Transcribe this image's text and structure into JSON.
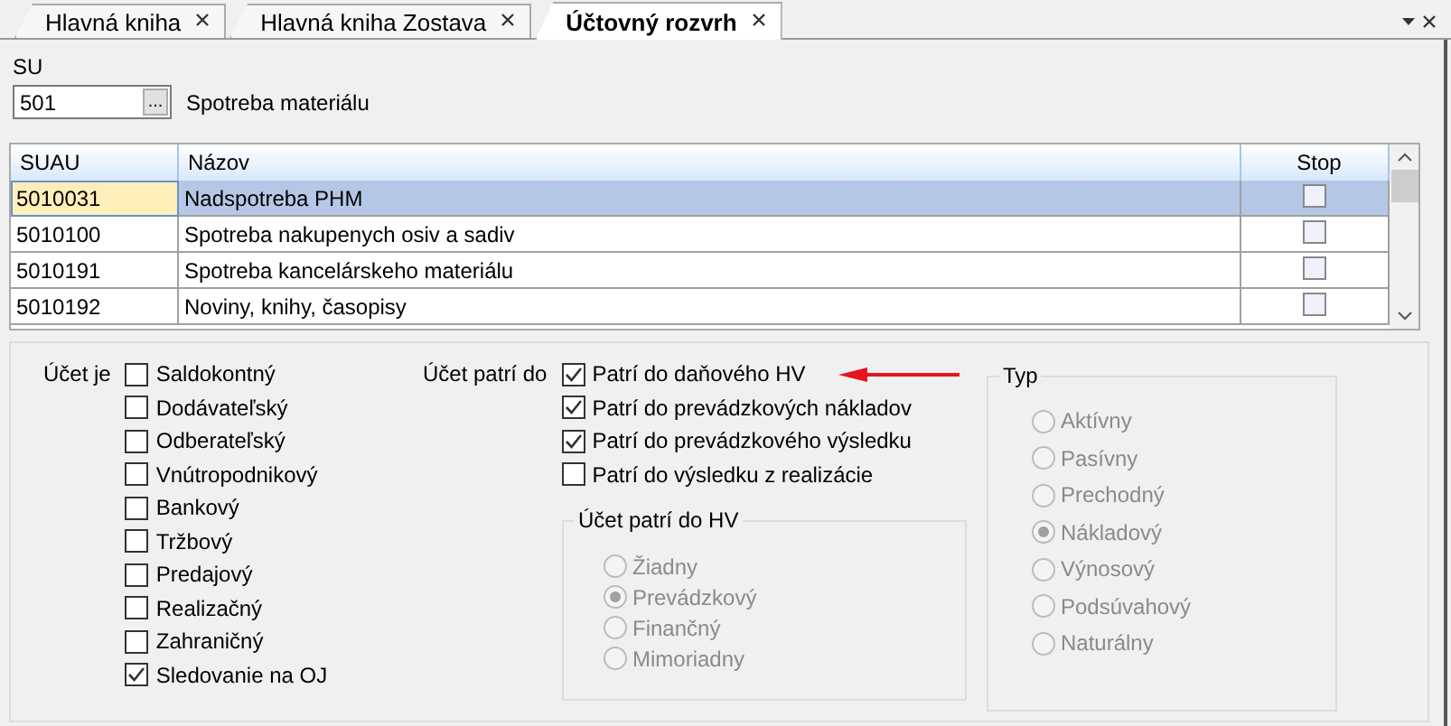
{
  "tabs": [
    {
      "label": "Hlavná kniha",
      "selected": false
    },
    {
      "label": "Hlavná kniha Zostava",
      "selected": false
    },
    {
      "label": "Účtovný rozvrh",
      "selected": true
    }
  ],
  "su": {
    "label": "SU",
    "value": "501",
    "button": "...",
    "description": "Spotreba materiálu"
  },
  "table": {
    "columns": [
      "SUAU",
      "Názov",
      "Stop"
    ],
    "rows": [
      {
        "suau": "5010031",
        "nazov": "Nadspotreba PHM",
        "stop": false,
        "selected": true
      },
      {
        "suau": "5010100",
        "nazov": "Spotreba nakupenych osiv a sadiv",
        "stop": false,
        "selected": false
      },
      {
        "suau": "5010191",
        "nazov": "Spotreba kancelárskeho materiálu",
        "stop": false,
        "selected": false
      },
      {
        "suau": "5010192",
        "nazov": "Noviny, knihy, časopisy",
        "stop": false,
        "selected": false
      }
    ]
  },
  "account_is": {
    "label": "Účet je",
    "items": [
      {
        "label": "Saldokontný",
        "checked": false
      },
      {
        "label": "Dodávateľský",
        "checked": false
      },
      {
        "label": "Odberateľský",
        "checked": false
      },
      {
        "label": "Vnútropodnikový",
        "checked": false
      },
      {
        "label": "Bankový",
        "checked": false
      },
      {
        "label": "Tržbový",
        "checked": false
      },
      {
        "label": "Predajový",
        "checked": false
      },
      {
        "label": "Realizačný",
        "checked": false
      },
      {
        "label": "Zahraničný",
        "checked": false
      },
      {
        "label": "Sledovanie na OJ",
        "checked": true
      }
    ]
  },
  "belongs_to": {
    "label": "Účet patrí do",
    "items": [
      {
        "label": "Patrí do daňového HV",
        "checked": true,
        "annotated": true
      },
      {
        "label": "Patrí do prevádzkových nákladov",
        "checked": true,
        "annotated": false
      },
      {
        "label": "Patrí do prevádzkového výsledku",
        "checked": true,
        "annotated": false
      },
      {
        "label": "Patrí do výsledku z realizácie",
        "checked": false,
        "annotated": false
      }
    ]
  },
  "hv_group": {
    "title": "Účet patrí do HV",
    "disabled": true,
    "options": [
      {
        "label": "Žiadny",
        "selected": false
      },
      {
        "label": "Prevádzkový",
        "selected": true
      },
      {
        "label": "Finančný",
        "selected": false
      },
      {
        "label": "Mimoriadny",
        "selected": false
      }
    ]
  },
  "type_group": {
    "title": "Typ",
    "disabled": true,
    "options": [
      {
        "label": "Aktívny",
        "selected": false
      },
      {
        "label": "Pasívny",
        "selected": false
      },
      {
        "label": "Prechodný",
        "selected": false
      },
      {
        "label": "Nákladový",
        "selected": true
      },
      {
        "label": "Výnosový",
        "selected": false
      },
      {
        "label": "Podsúvahový",
        "selected": false
      },
      {
        "label": "Naturálny",
        "selected": false
      }
    ]
  }
}
